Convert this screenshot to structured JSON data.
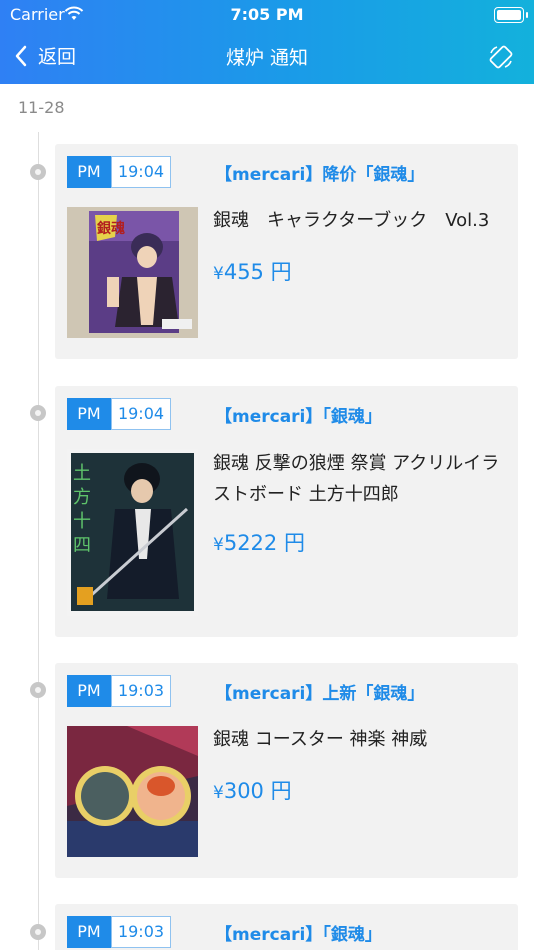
{
  "status_bar": {
    "carrier": "Carrier",
    "time": "7:05 PM"
  },
  "nav": {
    "back_label": "返回",
    "title": "煤炉 通知"
  },
  "date_label": "11-28",
  "entries": [
    {
      "ampm": "PM",
      "time": "19:04",
      "source": "【mercari】降价「銀魂」",
      "name": "銀魂　キャラクターブック　Vol.3",
      "price_symbol": "¥",
      "price": "455 円"
    },
    {
      "ampm": "PM",
      "time": "19:04",
      "source": "【mercari】「銀魂」",
      "name": "銀魂 反撃の狼煙 祭賞 アクリルイラストボード 土方十四郎",
      "price_symbol": "¥",
      "price": "5222 円"
    },
    {
      "ampm": "PM",
      "time": "19:03",
      "source": "【mercari】上新「銀魂」",
      "name": "銀魂 コースター 神楽 神威",
      "price_symbol": "¥",
      "price": "300 円"
    },
    {
      "ampm": "PM",
      "time": "19:03",
      "source": "【mercari】「銀魂」"
    }
  ],
  "colors": {
    "accent": "#1f8be8",
    "header_start": "#2f80f4",
    "header_end": "#13b1dc",
    "card_bg": "#f2f2f2"
  }
}
